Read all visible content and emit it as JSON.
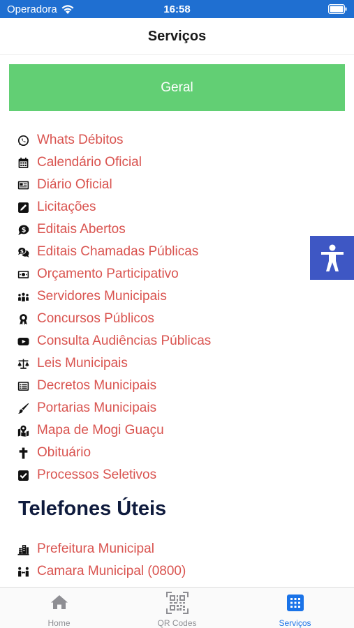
{
  "status_bar": {
    "carrier": "Operadora",
    "time": "16:58"
  },
  "header": {
    "title": "Serviços"
  },
  "geral_button": {
    "label": "Geral"
  },
  "services": [
    {
      "label": "Whats Débitos",
      "icon": "whatsapp-icon"
    },
    {
      "label": "Calendário Oficial",
      "icon": "calendar-icon"
    },
    {
      "label": "Diário Oficial",
      "icon": "newspaper-icon"
    },
    {
      "label": "Licitações",
      "icon": "edit-square-icon"
    },
    {
      "label": "Editais Abertos",
      "icon": "comment-dollar-icon"
    },
    {
      "label": "Editais Chamadas Públicas",
      "icon": "comments-dollar-icon"
    },
    {
      "label": "Orçamento Participativo",
      "icon": "money-bill-icon"
    },
    {
      "label": "Servidores Municipais",
      "icon": "people-group-icon"
    },
    {
      "label": "Concursos Públicos",
      "icon": "award-icon"
    },
    {
      "label": "Consulta Audiências Públicas",
      "icon": "youtube-icon"
    },
    {
      "label": "Leis Municipais",
      "icon": "balance-scale-icon"
    },
    {
      "label": "Decretos Municipais",
      "icon": "list-alt-icon"
    },
    {
      "label": "Portarias Municipais",
      "icon": "pen-brush-icon"
    },
    {
      "label": "Mapa de Mogi Guaçu",
      "icon": "map-marked-icon"
    },
    {
      "label": "Obituário",
      "icon": "cross-icon"
    },
    {
      "label": "Processos Seletivos",
      "icon": "check-square-icon"
    }
  ],
  "phones_section": {
    "heading": "Telefones Úteis",
    "items": [
      {
        "label": "Prefeitura Municipal",
        "icon": "building-icon"
      },
      {
        "label": "Camara Municipal (0800)",
        "icon": "people-arrows-icon"
      }
    ]
  },
  "tab_bar": {
    "tabs": [
      {
        "label": "Home",
        "icon": "home-icon",
        "active": false
      },
      {
        "label": "QR Codes",
        "icon": "qrcode-icon",
        "active": false
      },
      {
        "label": "Serviços",
        "icon": "grid-icon",
        "active": true
      }
    ]
  },
  "colors": {
    "accent_blue": "#1a73e8",
    "status_bar": "#1f6fd1",
    "geral_green": "#62cf74",
    "link_red": "#d9534f",
    "heading_navy": "#0f1b3d",
    "accessibility_blue": "#3e57c4"
  }
}
